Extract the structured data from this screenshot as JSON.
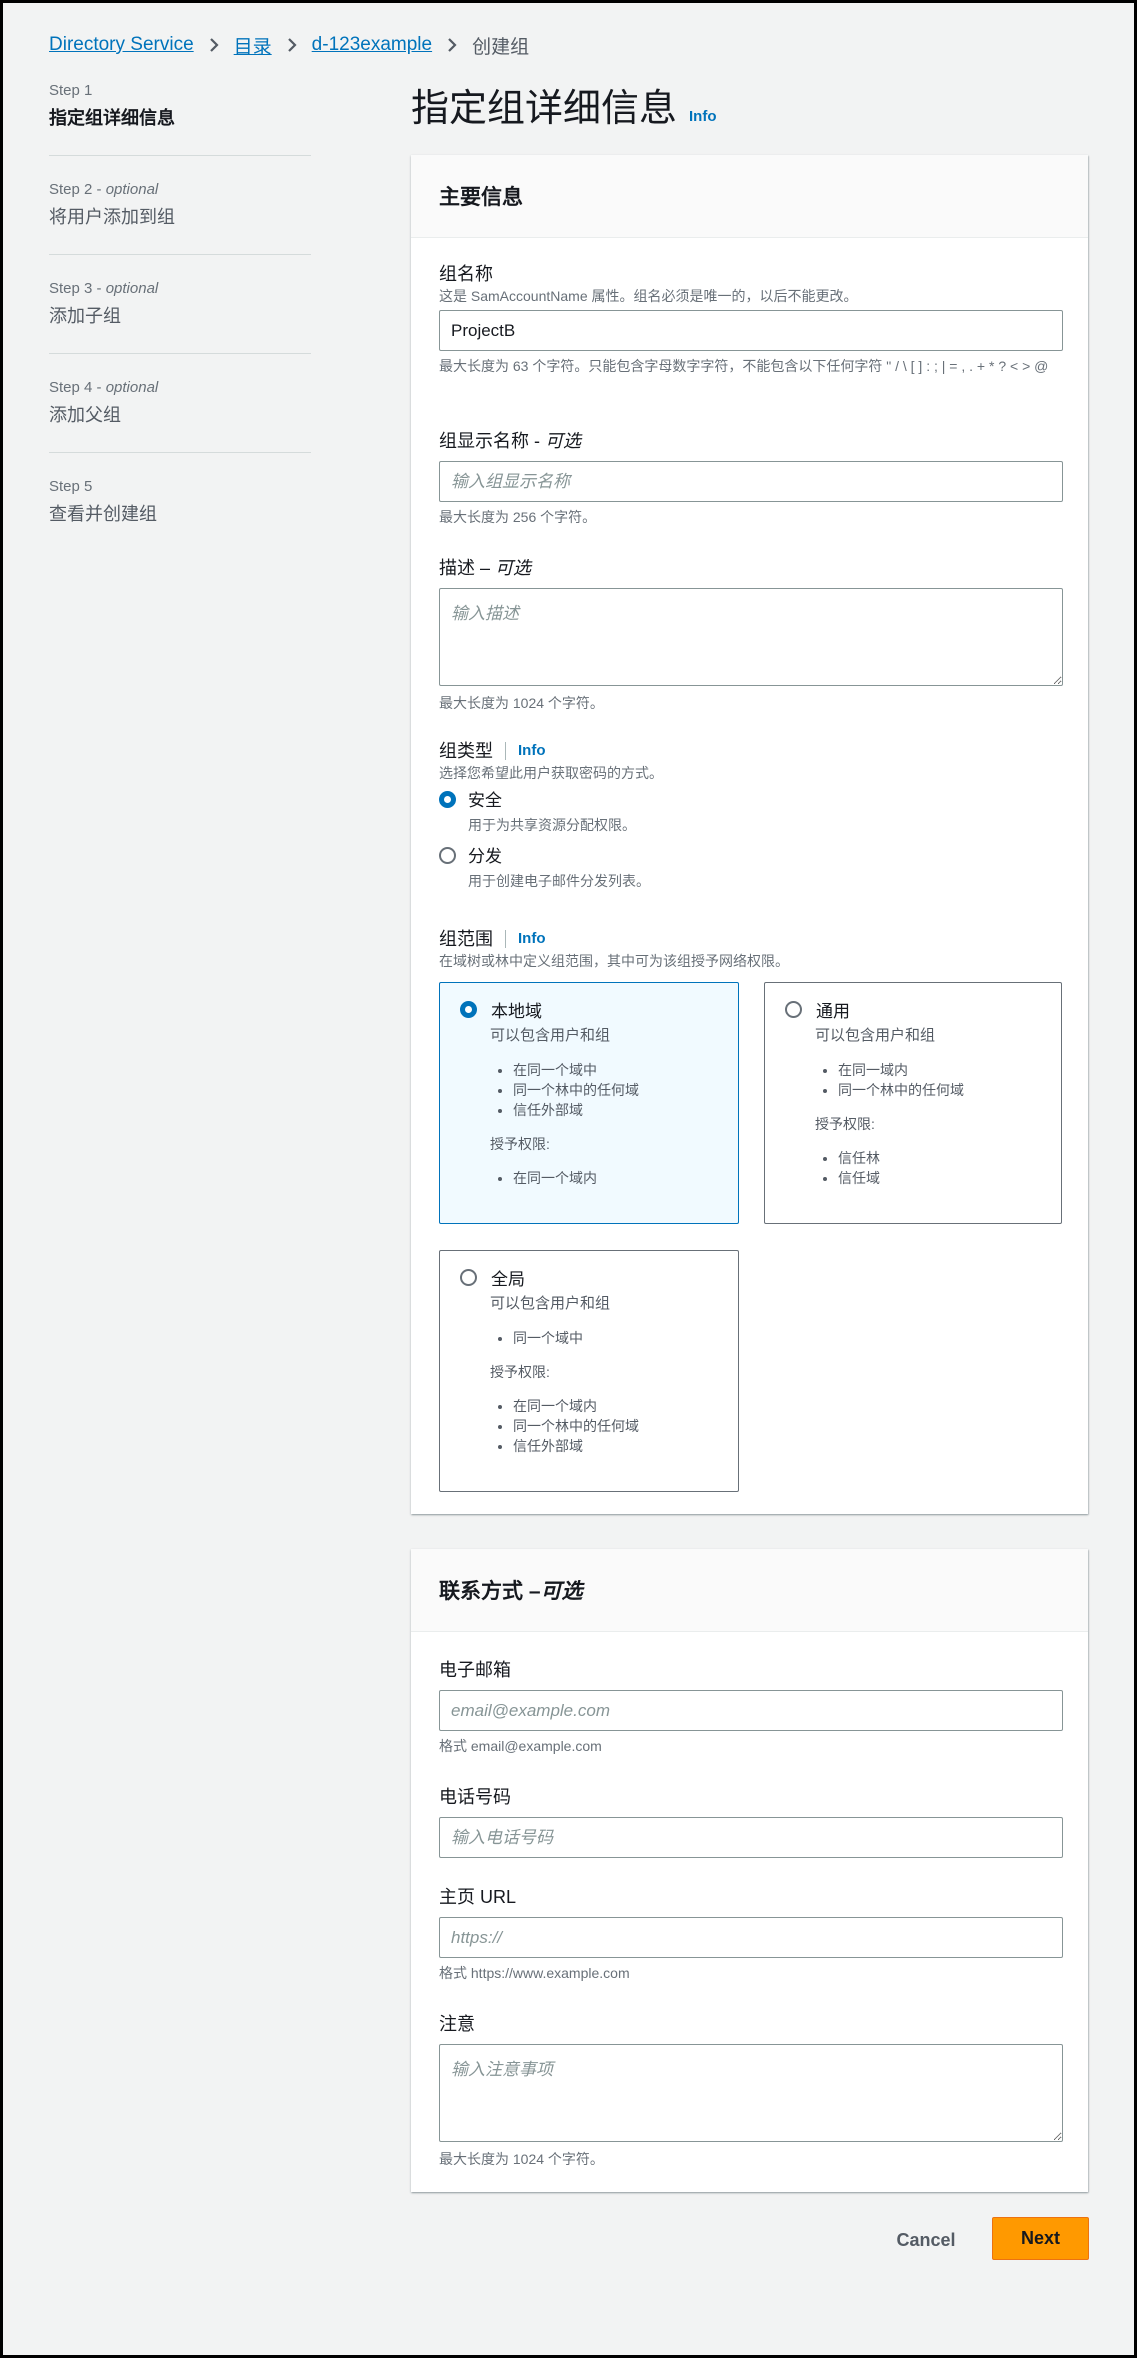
{
  "breadcrumb": {
    "items": [
      "Directory Service",
      "目录",
      "d-123example"
    ],
    "current": "创建组"
  },
  "steps": [
    {
      "num": "Step 1",
      "optional": "",
      "title": "指定组详细信息"
    },
    {
      "num": "Step 2 - ",
      "optional": "optional",
      "title": "将用户添加到组"
    },
    {
      "num": "Step 3 - ",
      "optional": "optional",
      "title": "添加子组"
    },
    {
      "num": "Step 4 - ",
      "optional": "optional",
      "title": "添加父组"
    },
    {
      "num": "Step 5",
      "optional": "",
      "title": "查看并创建组"
    }
  ],
  "page": {
    "title": "指定组详细信息",
    "info": "Info"
  },
  "main_panel": {
    "header": "主要信息",
    "group_name": {
      "label": "组名称",
      "description": "这是 SamAccountName 属性。组名必须是唯一的，以后不能更改。",
      "value": "ProjectB",
      "constraint": "最大长度为 63 个字符。只能包含字母数字字符，不能包含以下任何字符 \" / \\ [ ] : ; | = , . + * ? < > @"
    },
    "display_name": {
      "label": "组显示名称 - ",
      "optional": "可选",
      "placeholder": "输入组显示名称",
      "constraint": "最大长度为 256 个字符。"
    },
    "description": {
      "label": "描述 – ",
      "optional": "可选",
      "placeholder": "输入描述",
      "constraint": "最大长度为 1024 个字符。"
    },
    "group_type": {
      "label": "组类型",
      "info": "Info",
      "description": "选择您希望此用户获取密码的方式。",
      "options": [
        {
          "title": "安全",
          "sub": "用于为共享资源分配权限。",
          "selected": true
        },
        {
          "title": "分发",
          "sub": "用于创建电子邮件分发列表。",
          "selected": false
        }
      ]
    },
    "group_scope": {
      "label": "组范围",
      "info": "Info",
      "description": "在域树或林中定义组范围，其中可为该组授予网络权限。",
      "cards": [
        {
          "title": "本地域",
          "sub": "可以包含用户和组",
          "members": [
            "在同一个域中",
            "同一个林中的任何域",
            "信任外部域"
          ],
          "grant_label": "授予权限:",
          "grants": [
            "在同一个域内"
          ],
          "selected": true
        },
        {
          "title": "通用",
          "sub": "可以包含用户和组",
          "members": [
            "在同一域内",
            "同一个林中的任何域"
          ],
          "grant_label": "授予权限:",
          "grants": [
            "信任林",
            "信任域"
          ],
          "selected": false
        },
        {
          "title": "全局",
          "sub": "可以包含用户和组",
          "members": [
            "同一个域中"
          ],
          "grant_label": "授予权限:",
          "grants": [
            "在同一个域内",
            "同一个林中的任何域",
            "信任外部域"
          ],
          "selected": false
        }
      ]
    }
  },
  "contact_panel": {
    "header": "联系方式 – ",
    "header_optional": "可选",
    "email": {
      "label": "电子邮箱",
      "placeholder": "email@example.com",
      "hint": "格式 email@example.com"
    },
    "phone": {
      "label": "电话号码",
      "placeholder": "输入电话号码"
    },
    "homepage": {
      "label": "主页 URL",
      "placeholder": "https://",
      "hint": "格式 https://www.example.com"
    },
    "notes": {
      "label": "注意",
      "placeholder": "输入注意事项",
      "hint": "最大长度为 1024 个字符。"
    }
  },
  "actions": {
    "cancel": "Cancel",
    "next": "Next"
  },
  "colors": {
    "link": "#0073bb",
    "primary_button": "#ff9900",
    "selected_card_bg": "#f1faff"
  }
}
